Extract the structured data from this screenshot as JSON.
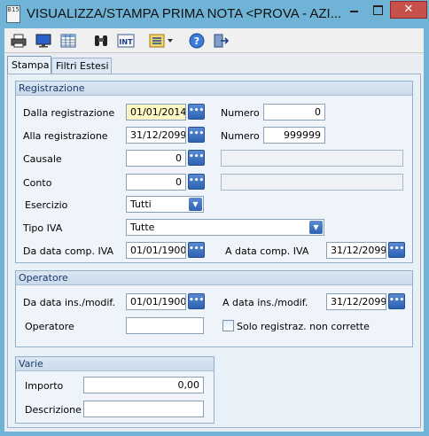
{
  "window": {
    "app_icon": "B15",
    "title": "VISUALIZZA/STAMPA PRIMA NOTA <PROVA - AZI...",
    "close_glyph": "✕"
  },
  "toolbar": {
    "icons": [
      "printer-icon",
      "monitor-icon",
      "table-icon",
      "binoculars-icon",
      "int-icon",
      "list-dropdown-icon",
      "help-icon",
      "exit-icon"
    ],
    "int_label": "INT"
  },
  "tabs": [
    {
      "label": "Stampa",
      "active": true
    },
    {
      "label": "Filtri Estesi",
      "active": false
    }
  ],
  "registrazione": {
    "header": "Registrazione",
    "dalla_label": "Dalla registrazione",
    "dalla_value": "01/01/2014",
    "numero_from_label": "Numero",
    "numero_from_value": "0",
    "alla_label": "Alla registrazione",
    "alla_value": "31/12/2099",
    "numero_to_label": "Numero",
    "numero_to_value": "999999",
    "causale_label": "Causale",
    "causale_value": "0",
    "causale_desc": "",
    "conto_label": "Conto",
    "conto_value": "0",
    "conto_desc": "",
    "esercizio_label": "Esercizio",
    "esercizio_value": "Tutti",
    "tipo_iva_label": "Tipo IVA",
    "tipo_iva_value": "Tutte",
    "da_comp_iva_label": "Da data comp. IVA",
    "da_comp_iva_value": "01/01/1900",
    "a_comp_iva_label": "A data comp. IVA",
    "a_comp_iva_value": "31/12/2099"
  },
  "operatore": {
    "header": "Operatore",
    "da_ins_label": "Da data ins./modif.",
    "da_ins_value": "01/01/1900",
    "a_ins_label": "A data ins./modif.",
    "a_ins_value": "31/12/2099",
    "operatore_label": "Operatore",
    "operatore_value": "",
    "solo_label": "Solo registraz. non corrette",
    "solo_checked": false
  },
  "varie": {
    "header": "Varie",
    "importo_label": "Importo",
    "importo_value": "0,00",
    "descrizione_label": "Descrizione",
    "descrizione_value": ""
  },
  "colors": {
    "titlebar": "#6fb3d6",
    "accent_button": "#2d62b4",
    "highlight_field": "#fff8c4",
    "close_button": "#c7504a"
  }
}
